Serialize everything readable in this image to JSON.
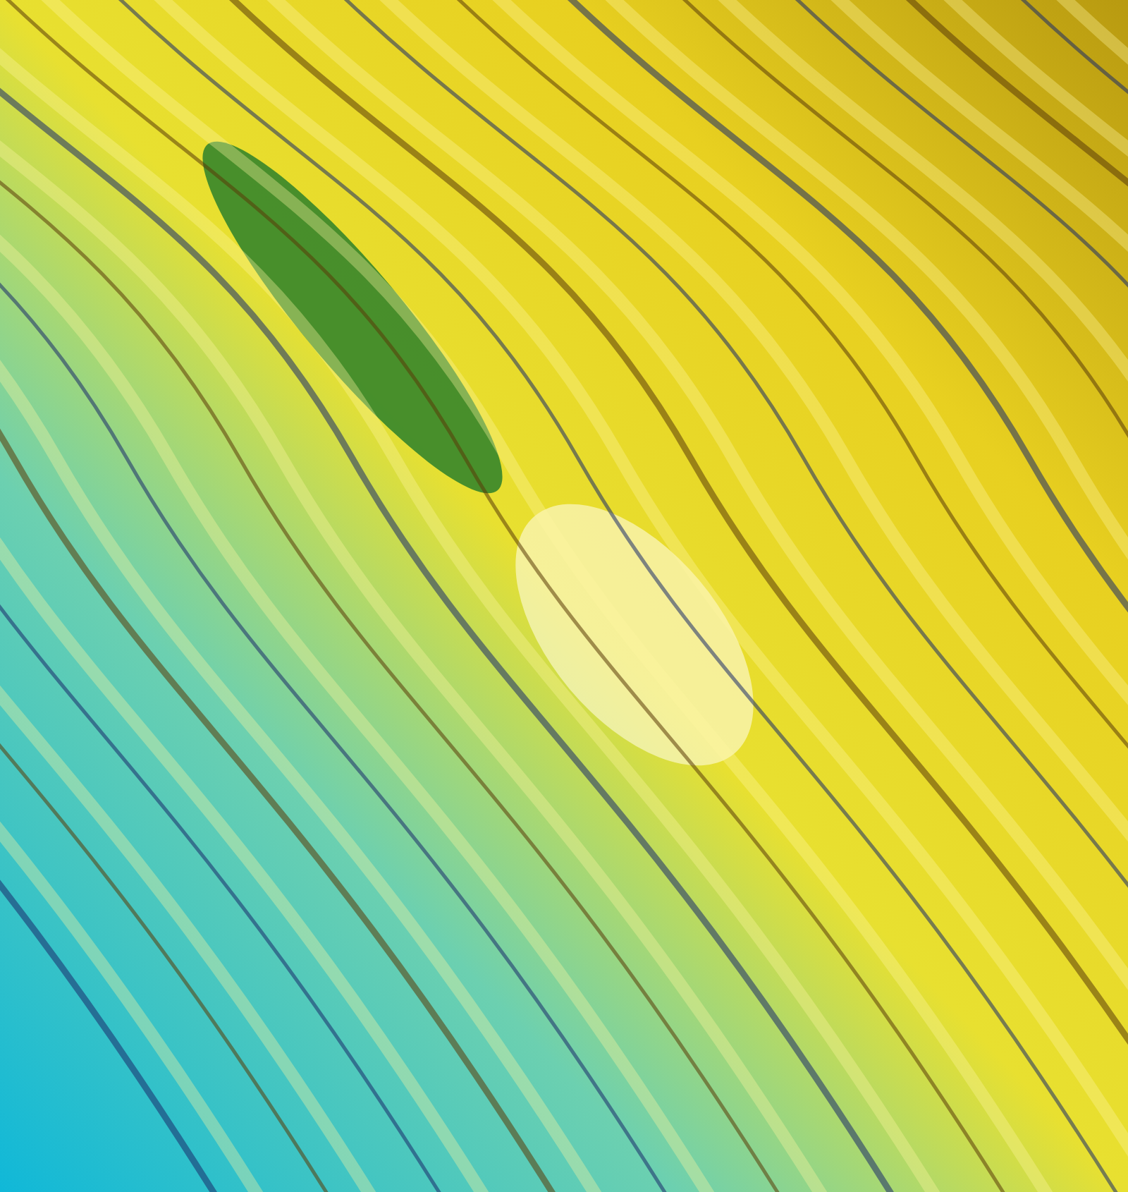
{
  "artwork": {
    "kind": "abstract"
  }
}
